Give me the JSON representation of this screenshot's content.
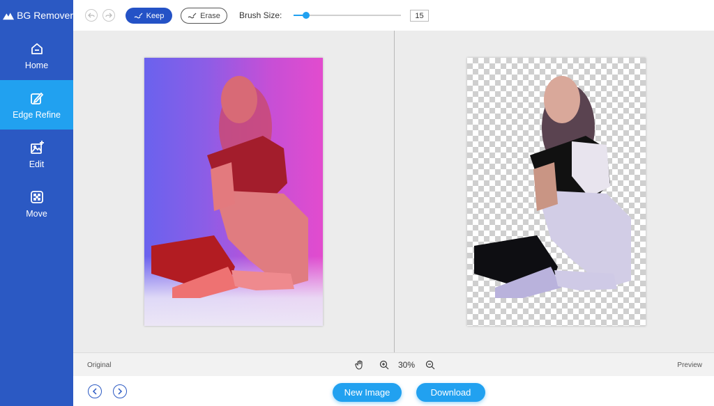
{
  "app": {
    "title": "BG Remover"
  },
  "sidebar": {
    "items": [
      {
        "label": "Home",
        "icon": "home-icon"
      },
      {
        "label": "Edge Refine",
        "icon": "edge-refine-icon",
        "active": true
      },
      {
        "label": "Edit",
        "icon": "edit-image-icon"
      },
      {
        "label": "Move",
        "icon": "move-icon"
      }
    ]
  },
  "toolbar": {
    "keep_label": "Keep",
    "erase_label": "Erase",
    "brush_size_label": "Brush Size:",
    "brush_size_value": "15",
    "brush_size_fraction": 0.12
  },
  "status": {
    "original_label": "Original",
    "preview_label": "Preview",
    "zoom_level": "30%"
  },
  "footer": {
    "new_image_label": "New Image",
    "download_label": "Download"
  },
  "colors": {
    "sidebar": "#2b59c3",
    "accent": "#21a1f0",
    "keep_button": "#2452c6"
  }
}
